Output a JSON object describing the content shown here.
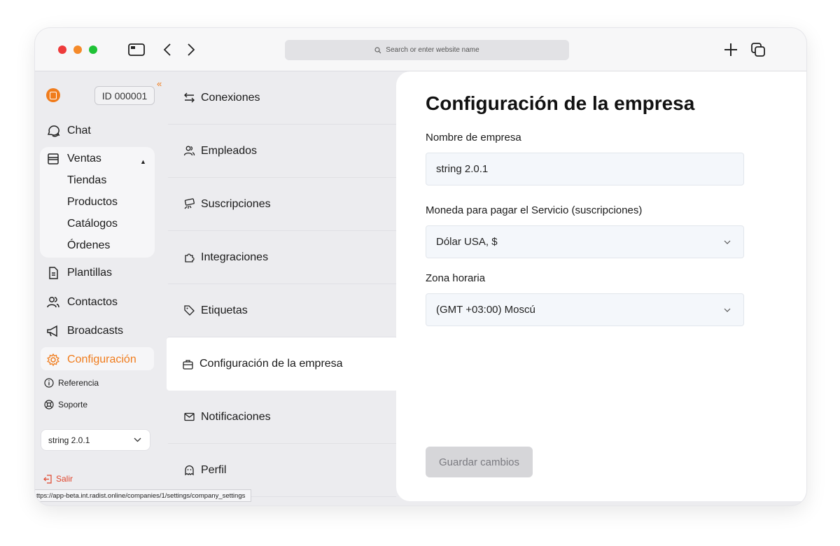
{
  "browser": {
    "address_placeholder": "Search or enter website name",
    "status_url": "ttps://app-beta.int.radist.online/companies/1/settings/company_settings"
  },
  "sidebar": {
    "collapse_glyph": "«",
    "id_badge": "ID 000001",
    "items": {
      "chat": "Chat",
      "ventas": "Ventas",
      "ventas_sub": [
        "Tiendas",
        "Productos",
        "Catálogos",
        "Órdenes"
      ],
      "plantillas": "Plantillas",
      "contactos": "Contactos",
      "broadcasts": "Broadcasts",
      "configuracion": "Configuración"
    },
    "referencia": "Referencia",
    "soporte": "Soporte",
    "company_select": "string 2.0.1",
    "logout": "Salir",
    "accent_color": "#f07c1c"
  },
  "settings_menu": {
    "items": [
      {
        "label": "Conexiones",
        "icon": "arrows-icon"
      },
      {
        "label": "Empleados",
        "icon": "users-icon"
      },
      {
        "label": "Suscripciones",
        "icon": "money-icon"
      },
      {
        "label": "Integraciones",
        "icon": "puzzle-icon"
      },
      {
        "label": "Etiquetas",
        "icon": "tag-icon"
      },
      {
        "label": "Configuración de la empresa",
        "icon": "briefcase-icon",
        "active": true
      },
      {
        "label": "Notificaciones",
        "icon": "mail-icon"
      },
      {
        "label": "Perfil",
        "icon": "ghost-icon"
      }
    ]
  },
  "main": {
    "title": "Configuración de la empresa",
    "company_name_label": "Nombre de empresa",
    "company_name_value": "string 2.0.1",
    "currency_label": "Moneda para pagar el Servicio (suscripciones)",
    "currency_value": "Dólar USA, $",
    "timezone_label": "Zona horaria",
    "timezone_value": "(GMT +03:00) Moscú",
    "save_button": "Guardar cambios"
  }
}
